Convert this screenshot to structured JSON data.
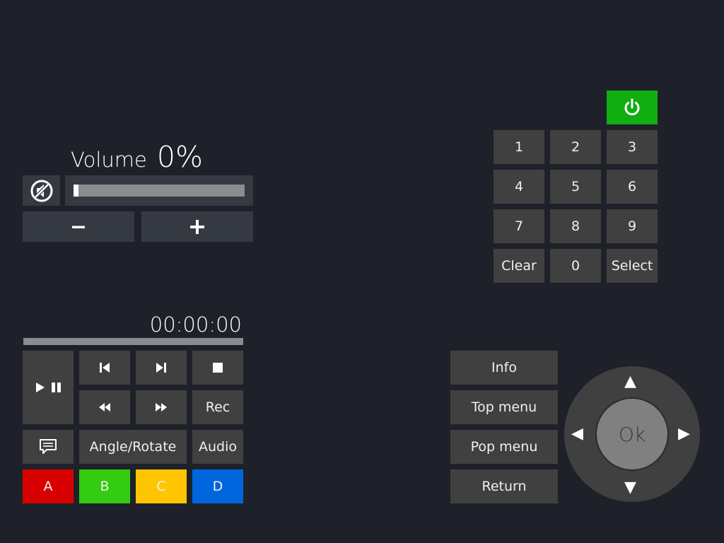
{
  "colors": {
    "background": "#1e2129",
    "button": "#404040",
    "power": "#11ad11",
    "color_a": "#d90000",
    "color_b": "#33cc11",
    "color_c": "#ffc500",
    "color_d": "#0066dd"
  },
  "volume": {
    "label": "Volume",
    "value": "0%",
    "level": 0.03,
    "mute_icon": "mute-icon",
    "minus_icon": "minus-icon",
    "plus_icon": "plus-icon"
  },
  "power": {
    "icon": "power-icon"
  },
  "keypad": {
    "keys": [
      "1",
      "2",
      "3",
      "4",
      "5",
      "6",
      "7",
      "8",
      "9",
      "Clear",
      "0",
      "Select"
    ]
  },
  "transport": {
    "time": "00:00:00",
    "progress": 0,
    "play_pause_icon": "play-pause-icon",
    "prev_icon": "skip-previous-icon",
    "next_icon": "skip-next-icon",
    "stop_icon": "stop-icon",
    "rewind_icon": "rewind-icon",
    "forward_icon": "fast-forward-icon",
    "rec_label": "Rec",
    "subtitle_icon": "subtitle-icon",
    "angle_label": "Angle/Rotate",
    "audio_label": "Audio"
  },
  "color_keys": {
    "a": "A",
    "b": "B",
    "c": "C",
    "d": "D"
  },
  "menu": {
    "info": "Info",
    "top_menu": "Top menu",
    "pop_menu": "Pop menu",
    "return": "Return"
  },
  "dpad": {
    "ok": "Ok",
    "up": "▲",
    "down": "▼",
    "left": "◀",
    "right": "▶"
  }
}
